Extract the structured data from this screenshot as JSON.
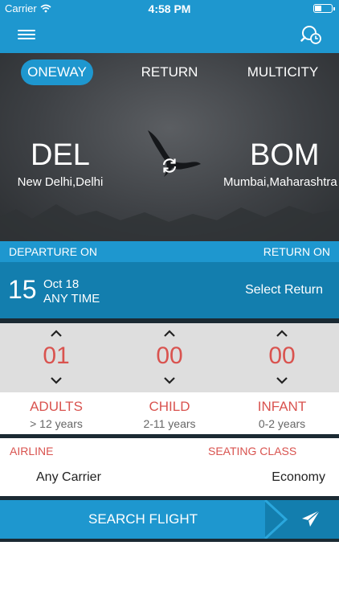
{
  "status_bar": {
    "carrier": "Carrier",
    "time": "4:58 PM"
  },
  "trip_tabs": {
    "oneway": "ONEWAY",
    "return": "RETURN",
    "multicity": "MULTICITY",
    "active": "oneway"
  },
  "from": {
    "code": "DEL",
    "name": "New Delhi,Delhi"
  },
  "to": {
    "code": "BOM",
    "name": "Mumbai,Maharashtra"
  },
  "departure": {
    "label": "DEPARTURE ON",
    "day": "15",
    "month": "Oct 18",
    "time": "ANY TIME"
  },
  "return": {
    "label": "RETURN ON",
    "placeholder": "Select Return"
  },
  "passengers": {
    "adults": {
      "count": "01",
      "label": "ADULTS",
      "range": "> 12 years"
    },
    "child": {
      "count": "00",
      "label": "CHILD",
      "range": "2-11 years"
    },
    "infant": {
      "count": "00",
      "label": "INFANT",
      "range": "0-2 years"
    }
  },
  "airline": {
    "label": "AIRLINE",
    "value": "Any Carrier"
  },
  "seating_class": {
    "label": "SEATING CLASS",
    "value": "Economy"
  },
  "search_button": {
    "label": "SEARCH FLIGHT"
  },
  "icons": {
    "menu": "hamburger-menu-icon",
    "history": "search-history-icon",
    "swap": "swap-icon",
    "plane": "airplane-icon"
  },
  "colors": {
    "primary": "#1e97cf",
    "primary_dark": "#137eae",
    "accent_red": "#d9534f",
    "counter_bg": "#dedede",
    "divider": "#1b2a33"
  }
}
